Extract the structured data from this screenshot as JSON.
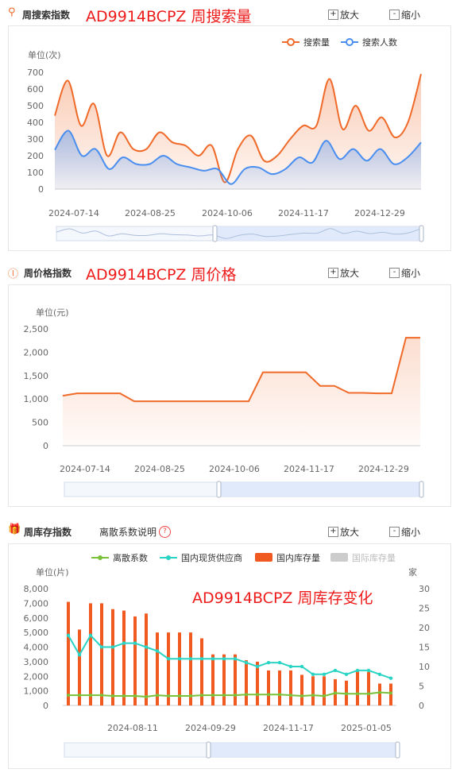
{
  "sections": {
    "search": {
      "title": "周搜索指数",
      "overlay": "AD9914BCPZ 周搜索量",
      "zoom_in": "放大",
      "zoom_out": "缩小"
    },
    "price": {
      "title": "周价格指数",
      "overlay": "AD9914BCPZ 周价格",
      "zoom_in": "放大",
      "zoom_out": "缩小"
    },
    "stock": {
      "title": "周库存指数",
      "help_label": "离散系数说明",
      "overlay": "AD9914BCPZ 周库存变化",
      "zoom_in": "放大",
      "zoom_out": "缩小"
    }
  },
  "colors": {
    "orange": "#f06a2a",
    "blue": "#4a8ff0",
    "green": "#7ac13a",
    "teal": "#2ad4c4",
    "bar": "#f05a20",
    "gray": "#cccccc"
  },
  "chart_data": [
    {
      "type": "line",
      "title": "",
      "ylabel": "单位(次)",
      "yticks": [
        "0",
        "100",
        "200",
        "300",
        "400",
        "500",
        "600",
        "700"
      ],
      "ylim": [
        0,
        700
      ],
      "xtick_labels": [
        "2024-07-14",
        "2024-08-25",
        "2024-10-06",
        "2024-11-17",
        "2024-12-29"
      ],
      "legend": [
        "搜索量",
        "搜索人数"
      ],
      "legend_position": "top-right",
      "n_points": 22,
      "series": [
        {
          "name": "搜索量",
          "values": [
            440,
            650,
            380,
            510,
            200,
            340,
            240,
            240,
            340,
            280,
            260,
            200,
            260,
            40,
            240,
            320,
            170,
            200,
            300,
            380,
            380,
            660,
            360,
            500,
            350,
            430,
            310,
            400,
            690
          ]
        },
        {
          "name": "搜索人数",
          "values": [
            235,
            350,
            200,
            240,
            120,
            190,
            150,
            150,
            200,
            150,
            130,
            110,
            120,
            30,
            120,
            130,
            90,
            120,
            190,
            160,
            290,
            180,
            240,
            170,
            240,
            150,
            190,
            280
          ]
        }
      ]
    },
    {
      "type": "line",
      "title": "",
      "ylabel": "单位(元)",
      "yticks": [
        "0",
        "500",
        "1,000",
        "1,500",
        "2,000",
        "2,500"
      ],
      "ylim": [
        0,
        2500
      ],
      "xtick_labels": [
        "2024-07-14",
        "2024-08-25",
        "2024-10-06",
        "2024-11-17",
        "2024-12-29"
      ],
      "series": [
        {
          "name": "价格",
          "values": [
            1070,
            1120,
            1120,
            1120,
            1120,
            950,
            950,
            950,
            950,
            950,
            950,
            950,
            950,
            950,
            1570,
            1570,
            1570,
            1570,
            1280,
            1280,
            1130,
            1130,
            1120,
            1120,
            2310,
            2310
          ]
        }
      ]
    },
    {
      "type": "bar",
      "title": "",
      "ylabel": "单位(片)",
      "y2label": "家",
      "yticks": [
        "0",
        "1,000",
        "2,000",
        "3,000",
        "4,000",
        "5,000",
        "6,000",
        "7,000",
        "8,000"
      ],
      "y2ticks": [
        "0",
        "5",
        "10",
        "15",
        "20",
        "25",
        "30"
      ],
      "ylim": [
        0,
        8000
      ],
      "y2lim": [
        0,
        30
      ],
      "xtick_labels": [
        "2024-08-11",
        "2024-09-29",
        "2024-11-17",
        "2025-01-05"
      ],
      "legend": [
        "离散系数",
        "国内现货供应商",
        "国内库存量",
        "国际库存量"
      ],
      "legend_position": "top",
      "series": [
        {
          "name": "国内库存量",
          "kind": "bar",
          "values": [
            7100,
            5200,
            7000,
            7000,
            6600,
            6500,
            6100,
            6300,
            5000,
            5000,
            5000,
            5000,
            4600,
            3500,
            3500,
            3500,
            3100,
            3000,
            2400,
            2400,
            2400,
            2100,
            2000,
            2000,
            1800,
            1700,
            2400,
            2300,
            1500,
            1500
          ]
        },
        {
          "name": "国内现货供应商",
          "kind": "line",
          "axis": "right",
          "values": [
            18,
            13,
            18,
            15,
            15,
            16,
            16,
            15,
            14,
            12,
            12,
            12,
            12,
            12,
            12,
            12,
            11,
            10,
            11,
            11,
            10,
            10,
            8,
            8,
            9,
            8,
            9,
            9,
            8,
            7
          ]
        },
        {
          "name": "离散系数",
          "kind": "line",
          "axis": "left",
          "values": [
            700,
            700,
            700,
            700,
            650,
            650,
            650,
            600,
            700,
            650,
            650,
            650,
            700,
            700,
            700,
            700,
            750,
            750,
            750,
            750,
            700,
            650,
            700,
            650,
            850,
            800,
            800,
            800,
            900,
            850
          ]
        }
      ]
    }
  ]
}
